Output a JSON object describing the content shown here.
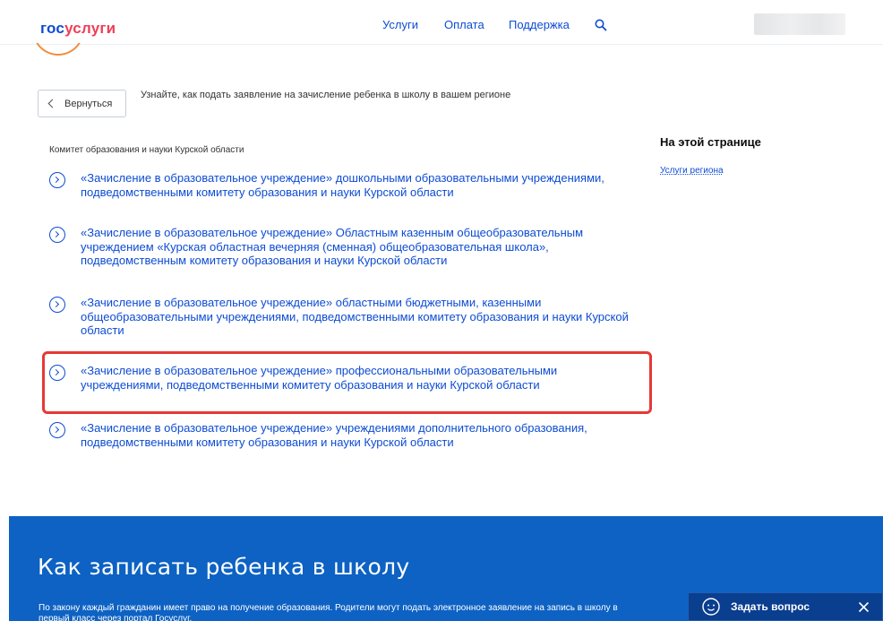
{
  "header": {
    "logo_part1": "гос",
    "logo_part2": "услуги",
    "nav": [
      "Услуги",
      "Оплата",
      "Поддержка"
    ],
    "search_icon": "search-icon"
  },
  "back_label": "Вернуться",
  "intro_text": "Узнайте, как подать заявление на зачисление ребенка в школу в вашем регионе",
  "committee": "Комитет образования и науки Курской области",
  "items": [
    "«Зачисление в образовательное учреждение» дошкольными образовательными учреждениями, подведомственными комитету образования и науки Курской области",
    "«Зачисление в образовательное учреждение» Областным казенным общеобразовательным учреждением «Курская областная вечерняя (сменная) общеобразовательная школа», подведомственным комитету образования и науки Курской области",
    "«Зачисление в образовательное учреждение» областными бюджетными, казенными общеобразовательными учреждениями, подведомственными комитету образования и науки Курской области",
    "«Зачисление в образовательное учреждение» профессиональными образовательными учреждениями, подведомственными комитету образования и науки Курской области",
    "«Зачисление в образовательное учреждение» учреждениями дополнительного образования, подведомственными комитету образования и науки Курской области"
  ],
  "sidebar": {
    "title": "На этой странице",
    "link": "Услуги региона"
  },
  "footer": {
    "heading": "Как записать ребенка в школу",
    "text": "По закону каждый гражданин имеет право на получение образования. Родители могут подать электронное заявление на запись в школу в первый класс через портал Госуслуг."
  },
  "chat": {
    "label": "Задать вопрос"
  },
  "colors": {
    "link": "#0d4cd3",
    "footer": "#0d62c3",
    "highlight": "#e53935"
  }
}
